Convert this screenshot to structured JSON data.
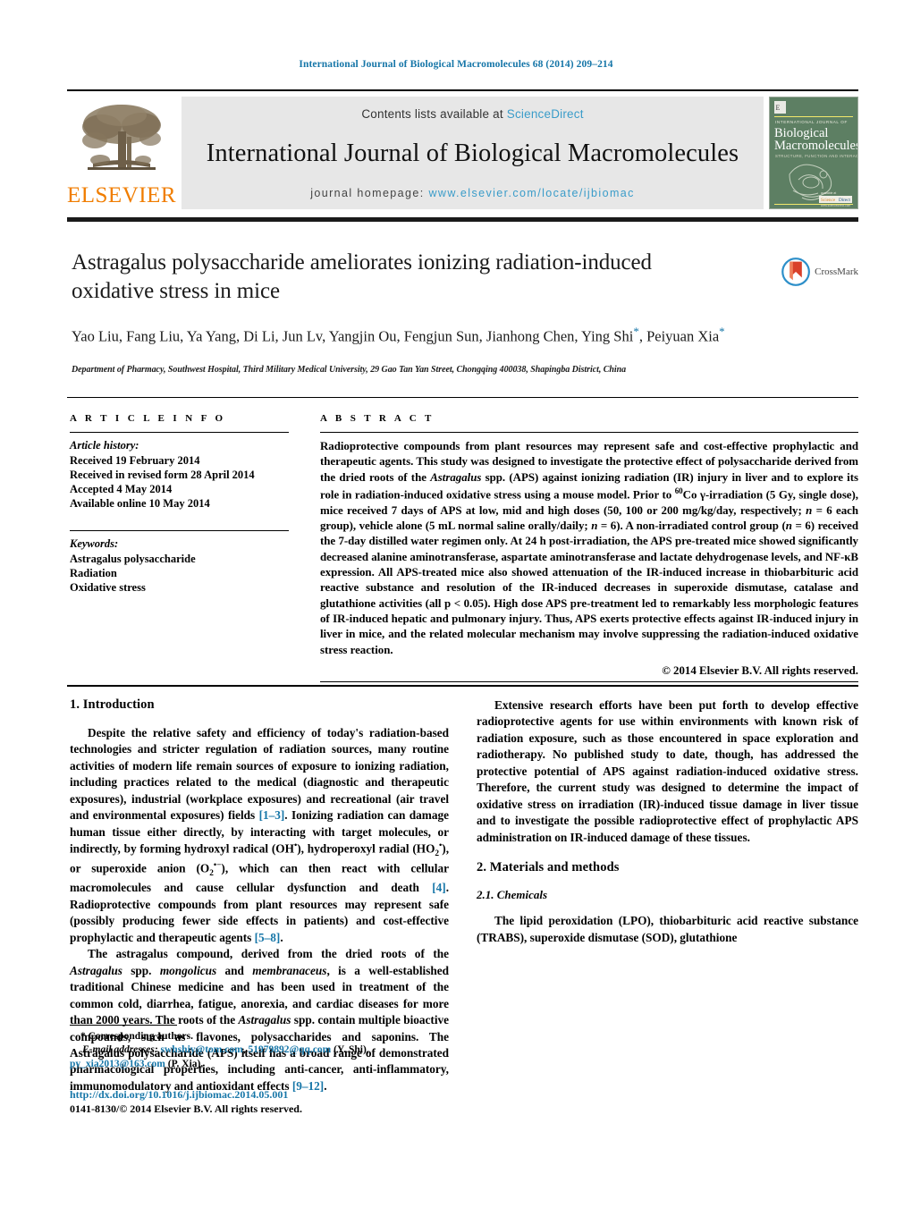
{
  "running_head": "International Journal of Biological Macromolecules 68 (2014) 209–214",
  "masthead": {
    "publisher_name": "ELSEVIER",
    "contents_prefix": "Contents lists available at ",
    "contents_link": "ScienceDirect",
    "journal_title": "International Journal of Biological Macromolecules",
    "homepage_prefix": "journal homepage: ",
    "homepage_url": "www.elsevier.com/locate/ijbiomac",
    "cover": {
      "line1": "INTERNATIONAL JOURNAL OF",
      "line2": "Biological",
      "line3": "Macromolecules",
      "line4": "STRUCTURE, FUNCTION AND INTERACTIONS",
      "footer1": "available at",
      "footer2": "ScienceDirect",
      "footer3": "www.sciencedirect.com"
    }
  },
  "article": {
    "title": "Astragalus polysaccharide ameliorates ionizing radiation-induced oxidative stress in mice",
    "crossmark_label": "CrossMark",
    "authors": "Yao Liu, Fang Liu, Ya Yang, Di Li, Jun Lv, Yangjin Ou, Fengjun Sun, Jianhong Chen, Ying Shi",
    "authors_line2_tail": ", Peiyuan Xia",
    "affiliation": "Department of Pharmacy, Southwest Hospital, Third Military Medical University, 29 Gao Tan Yan Street, Chongqing 400038, Shapingba District, China"
  },
  "article_info": {
    "heading": "A R T I C L E   I N F O",
    "history_label": "Article history:",
    "history": [
      "Received 19 February 2014",
      "Received in revised form 28 April 2014",
      "Accepted 4 May 2014",
      "Available online 10 May 2014"
    ],
    "keywords_label": "Keywords:",
    "keywords": [
      "Astragalus polysaccharide",
      "Radiation",
      "Oxidative stress"
    ]
  },
  "abstract": {
    "heading": "A B S T R A C T",
    "part1": "Radioprotective compounds from plant resources may represent safe and cost-effective prophylactic and therapeutic agents. This study was designed to investigate the protective effect of polysaccharide derived from the dried roots of the ",
    "species1": "Astragalus",
    "part2": " spp. (APS) against ionizing radiation (IR) injury in liver and to explore its role in radiation-induced oxidative stress using a mouse model. Prior to ",
    "isotope": "60",
    "part3": "Co γ-irradiation (5 Gy, single dose), mice received 7 days of APS at low, mid and high doses (50, 100 or 200 mg/kg/day, respectively; ",
    "n1": "n",
    "part4": " = 6 each group), vehicle alone (5 mL normal saline orally/daily; ",
    "n2": "n",
    "part5": " = 6). A non-irradiated control group (",
    "n3": "n",
    "part6": " = 6) received the 7-day distilled water regimen only. At 24 h post-irradiation, the APS pre-treated mice showed significantly decreased alanine aminotransferase, aspartate aminotransferase and lactate dehydrogenase levels, and NF-κB expression. All APS-treated mice also showed attenuation of the IR-induced increase in thiobarbituric acid reactive substance and resolution of the IR-induced decreases in superoxide dismutase, catalase and glutathione activities (all p < 0.05). High dose APS pre-treatment led to remarkably less morphologic features of IR-induced hepatic and pulmonary injury. Thus, APS exerts protective effects against IR-induced injury in liver in mice, and the related molecular mechanism may involve suppressing the radiation-induced oxidative stress reaction.",
    "copyright": "© 2014 Elsevier B.V. All rights reserved."
  },
  "body": {
    "intro_heading": "1.  Introduction",
    "p1_a": "Despite the relative safety and efficiency of today's radiation-based technologies and stricter regulation of radiation sources, many routine activities of modern life remain sources of exposure to ionizing radiation, including practices related to the medical (diagnostic and therapeutic exposures), industrial (workplace exposures) and recreational (air travel and environmental exposures) fields ",
    "p1_ref1": "[1–3]",
    "p1_b": ". Ionizing radiation can damage human tissue either directly, by interacting with target molecules, or indirectly, by forming hydroxyl radical (OH",
    "p1_c": "), hydroperoxyl radial (HO",
    "p1_d": "), or superoxide anion (O",
    "p1_e": "), which can then react with cellular macromolecules and cause cellular dysfunction and death ",
    "p1_ref2": "[4]",
    "p1_f": ". Radioprotective compounds from plant resources may represent safe (possibly producing fewer side effects in patients) and cost-effective prophylactic and therapeutic agents ",
    "p1_ref3": "[5–8]",
    "p1_g": ".",
    "p2_a": "The astragalus compound, derived from the dried roots of the ",
    "p2_sp1": "Astragalus",
    "p2_b": " spp. ",
    "p2_sp2": "mongolicus",
    "p2_c": " and ",
    "p2_sp3": "membranaceus",
    "p2_d": ", is a well-established traditional Chinese medicine and has been used in treatment of the common cold, diarrhea, fatigue, anorexia, and cardiac diseases for more than 2000 years. The roots of the ",
    "p2_sp4": "Astragalus",
    "p2_e": " spp. contain multiple bioactive compounds, such as flavones, polysaccharides and saponins. The Astragalus polysaccharide (APS) itself has a broad range of demonstrated pharmacological properties, including anti-cancer, anti-inflammatory, immunomodulatory and antioxidant effects ",
    "p2_ref": "[9–12]",
    "p2_f": ".",
    "p3": "Extensive research efforts have been put forth to develop effective radioprotective agents for use within environments with known risk of radiation exposure, such as those encountered in space exploration and radiotherapy. No published study to date, though, has addressed the protective potential of APS against radiation-induced oxidative stress. Therefore, the current study was designed to determine the impact of oxidative stress on irradiation (IR)-induced tissue damage in liver tissue and to investigate the possible radioprotective effect of prophylactic APS administration on IR-induced damage of these tissues.",
    "methods_heading": "2.  Materials and methods",
    "chemicals_heading": "2.1.  Chemicals",
    "p4": "The lipid peroxidation (LPO), thiobarbituric acid reactive substance (TRABS), superoxide dismutase (SOD), glutathione"
  },
  "footnote": {
    "corresponding": "* Corresponding authors.",
    "email_label": "E-mail addresses:",
    "email1": "swhshiy@tom.com",
    "email_sep": ", ",
    "email2": "51979892@qq.com",
    "email_attrib1": " (Y. Shi),",
    "email3": "py_xia2013@163.com",
    "email_attrib2": " (P. Xia).",
    "doi": "http://dx.doi.org/10.1016/j.ijbiomac.2014.05.001",
    "issn": "0141-8130/© 2014 Elsevier B.V. All rights reserved."
  },
  "colors": {
    "link_blue": "#1676a8",
    "sciencedirect_blue": "#3a9cc9",
    "elsevier_orange": "#f07d00",
    "masthead_grey": "#e7e7e7"
  }
}
